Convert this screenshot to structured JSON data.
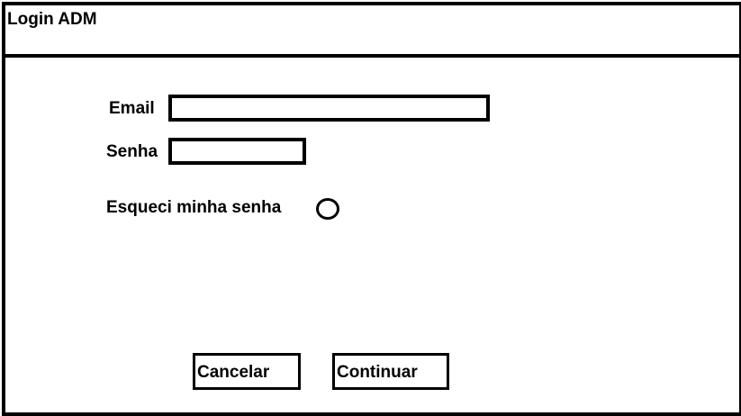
{
  "window": {
    "title": "Login ADM"
  },
  "form": {
    "email_label": "Email",
    "email_value": "",
    "senha_label": "Senha",
    "senha_value": "",
    "forgot_label": "Esqueci minha senha"
  },
  "buttons": {
    "cancel_label": "Cancelar",
    "continue_label": "Continuar"
  }
}
